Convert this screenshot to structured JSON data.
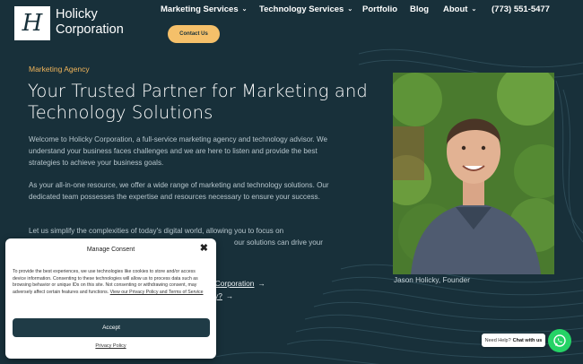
{
  "header": {
    "logo_mark": "H",
    "logo_line1": "Holicky",
    "logo_line2": "Corporation",
    "nav": [
      {
        "label": "Marketing Services",
        "has_dropdown": true
      },
      {
        "label": "Technology Services",
        "has_dropdown": true
      },
      {
        "label": "Portfolio",
        "has_dropdown": false
      },
      {
        "label": "Blog",
        "has_dropdown": false
      },
      {
        "label": "About",
        "has_dropdown": true
      },
      {
        "label": "(773) 551-5477",
        "has_dropdown": false
      }
    ],
    "cta_label": "Contact Us"
  },
  "hero": {
    "eyebrow": "Marketing Agency",
    "title": "Your Trusted Partner for Marketing and Technology Solutions",
    "paragraph1": "Welcome to Holicky Corporation, a full-service marketing agency and technology advisor.  We understand your business faces challenges and we are here to listen and provide the best strategies to achieve your business goals.",
    "paragraph2": "As your all-in-one resource, we offer a wide range of marketing and technology solutions. Our dedicated team possesses the expertise and resources necessary to ensure your success.",
    "paragraph3_visible": "Let us simplify the complexities of today's digital world, allowing you to focus on",
    "paragraph3_visible_end": "our solutions can drive your",
    "link1_visible": "ky Corporation",
    "link2_visible": "y?",
    "photo_caption": "Jason Holicky, Founder"
  },
  "consent": {
    "title": "Manage Consent",
    "body": "To provide the best experiences, we use technologies like cookies to store and/or access device information. Consenting to these technologies will allow us to process data such as browsing behavior or unique IDs on this site. Not consenting or withdrawing consent, may adversely affect certain features and functions.",
    "policy_link": "View our Privacy Policy and Terms of Service",
    "accept_label": "Accept",
    "privacy_label": "Privacy Policy"
  },
  "whatsapp": {
    "prompt": "Need Help?",
    "action": "Chat with us"
  },
  "colors": {
    "background": "#18303a",
    "accent": "#f5c06a",
    "eyebrow": "#f0b45a",
    "whatsapp": "#25d366"
  }
}
